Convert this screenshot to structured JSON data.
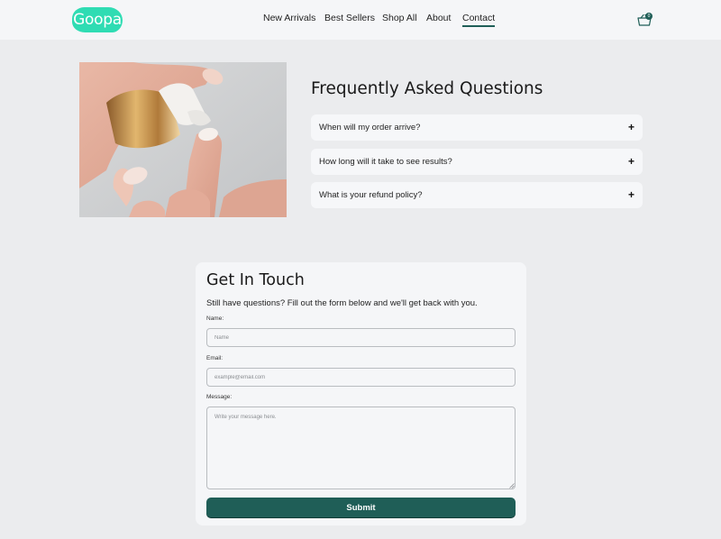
{
  "brand": {
    "logo_text": "Goopa",
    "accent": "#2fdcb3",
    "primary": "#1f5e57"
  },
  "nav": {
    "items": [
      {
        "label": "New Arrivals",
        "active": false
      },
      {
        "label": "Best Sellers",
        "active": false
      },
      {
        "label": "Shop All",
        "active": false
      },
      {
        "label": "About",
        "active": false
      },
      {
        "label": "Contact",
        "active": true
      }
    ],
    "cart": {
      "icon": "cart-icon",
      "count": "0"
    }
  },
  "hero": {
    "image": "hand-dispensing-serum-photo"
  },
  "faq": {
    "title": "Frequently Asked Questions",
    "items": [
      {
        "question": "When will my order arrive?",
        "icon": "plus-icon"
      },
      {
        "question": "How long will it take to see results?",
        "icon": "plus-icon"
      },
      {
        "question": "What is your refund policy?",
        "icon": "plus-icon"
      }
    ]
  },
  "contact": {
    "title": "Get In Touch",
    "subtitle": "Still have questions? Fill out the form below and we'll get back with you.",
    "name_label": "Name:",
    "name_placeholder": "Name",
    "name_value": "",
    "email_label": "Email:",
    "email_placeholder": "example@email.com",
    "email_value": "",
    "message_label": "Message:",
    "message_placeholder": "Write your message here.",
    "message_value": "",
    "submit_label": "Submit"
  }
}
